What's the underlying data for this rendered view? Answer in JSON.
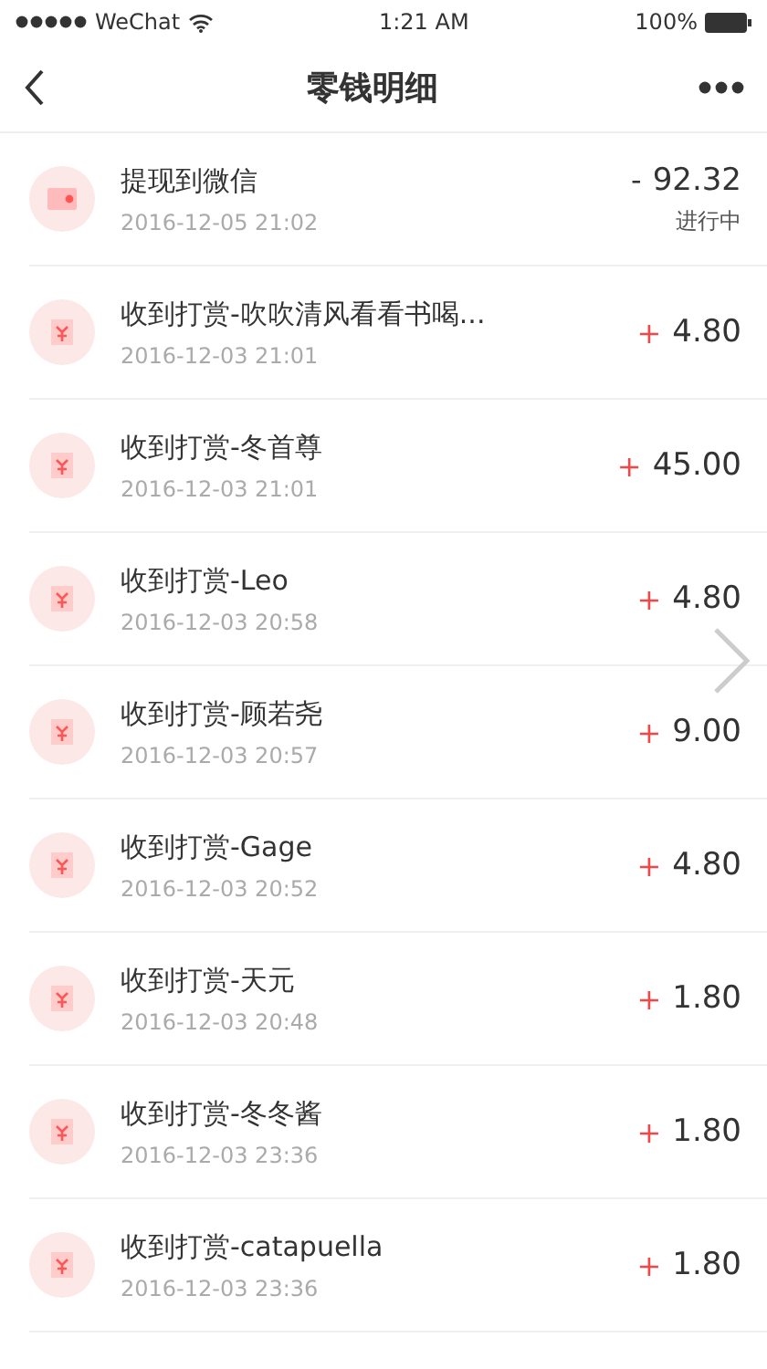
{
  "status_bar": {
    "carrier": "WeChat",
    "time": "1:21 AM",
    "battery": "100%"
  },
  "nav": {
    "title": "零钱明细"
  },
  "records": [
    {
      "kind": "withdrawal",
      "title": "提现到微信",
      "time": "2016-12-05 21:02",
      "sign": "-",
      "amount": "92.32",
      "status": "进行中"
    },
    {
      "kind": "income",
      "title": "收到打赏-吹吹清风看看书喝...",
      "time": "2016-12-03 21:01",
      "sign": "+",
      "amount": "4.80"
    },
    {
      "kind": "income",
      "title": "收到打赏-冬首尊",
      "time": "2016-12-03 21:01",
      "sign": "+",
      "amount": "45.00"
    },
    {
      "kind": "income",
      "title": "收到打赏-Leo",
      "time": "2016-12-03 20:58",
      "sign": "+",
      "amount": "4.80"
    },
    {
      "kind": "income",
      "title": "收到打赏-顾若尧",
      "time": "2016-12-03 20:57",
      "sign": "+",
      "amount": "9.00"
    },
    {
      "kind": "income",
      "title": "收到打赏-Gage",
      "time": "2016-12-03 20:52",
      "sign": "+",
      "amount": "4.80"
    },
    {
      "kind": "income",
      "title": "收到打赏-天元",
      "time": "2016-12-03 20:48",
      "sign": "+",
      "amount": "1.80"
    },
    {
      "kind": "income",
      "title": "收到打赏-冬冬酱",
      "time": "2016-12-03 23:36",
      "sign": "+",
      "amount": "1.80"
    },
    {
      "kind": "income",
      "title": "收到打赏-catapuella",
      "time": "2016-12-03 23:36",
      "sign": "+",
      "amount": "1.80"
    }
  ]
}
